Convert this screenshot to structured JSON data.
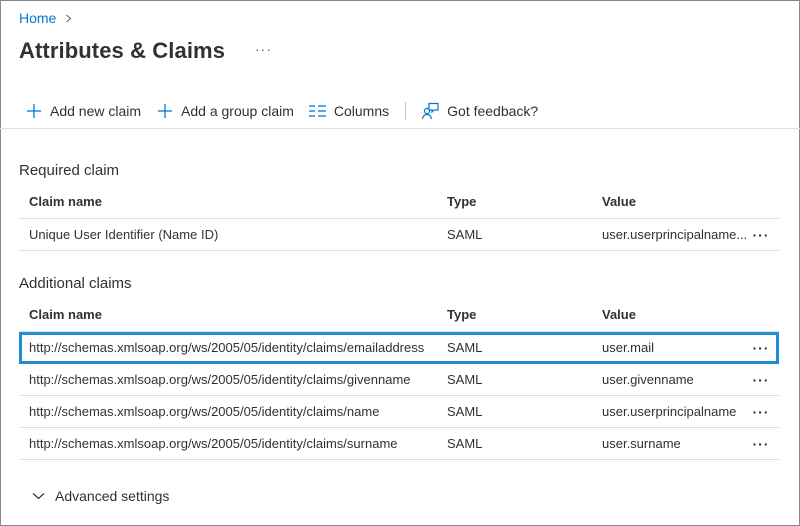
{
  "breadcrumb": {
    "home": "Home"
  },
  "page": {
    "title": "Attributes & Claims",
    "more": "···"
  },
  "toolbar": {
    "add_new_claim": "Add new claim",
    "add_group_claim": "Add a group claim",
    "columns": "Columns",
    "feedback": "Got feedback?"
  },
  "required": {
    "title": "Required claim",
    "headers": {
      "name": "Claim name",
      "type": "Type",
      "value": "Value"
    },
    "rows": [
      {
        "name": "Unique User Identifier (Name ID)",
        "type": "SAML",
        "value": "user.userprincipalname...",
        "more": "···"
      }
    ]
  },
  "additional": {
    "title": "Additional claims",
    "headers": {
      "name": "Claim name",
      "type": "Type",
      "value": "Value"
    },
    "rows": [
      {
        "name": "http://schemas.xmlsoap.org/ws/2005/05/identity/claims/emailaddress",
        "type": "SAML",
        "value": "user.mail",
        "more": "···"
      },
      {
        "name": "http://schemas.xmlsoap.org/ws/2005/05/identity/claims/givenname",
        "type": "SAML",
        "value": "user.givenname",
        "more": "···"
      },
      {
        "name": "http://schemas.xmlsoap.org/ws/2005/05/identity/claims/name",
        "type": "SAML",
        "value": "user.userprincipalname",
        "more": "···"
      },
      {
        "name": "http://schemas.xmlsoap.org/ws/2005/05/identity/claims/surname",
        "type": "SAML",
        "value": "user.surname",
        "more": "···"
      }
    ]
  },
  "advanced": {
    "label": "Advanced settings"
  },
  "colors": {
    "accent": "#0078d4",
    "selection": "#1e8fd6",
    "divider": "#e1dfdd"
  },
  "icons": [
    "chevron-right-icon",
    "plus-icon",
    "columns-icon",
    "feedback-icon",
    "chevron-down-icon",
    "more-icon"
  ]
}
